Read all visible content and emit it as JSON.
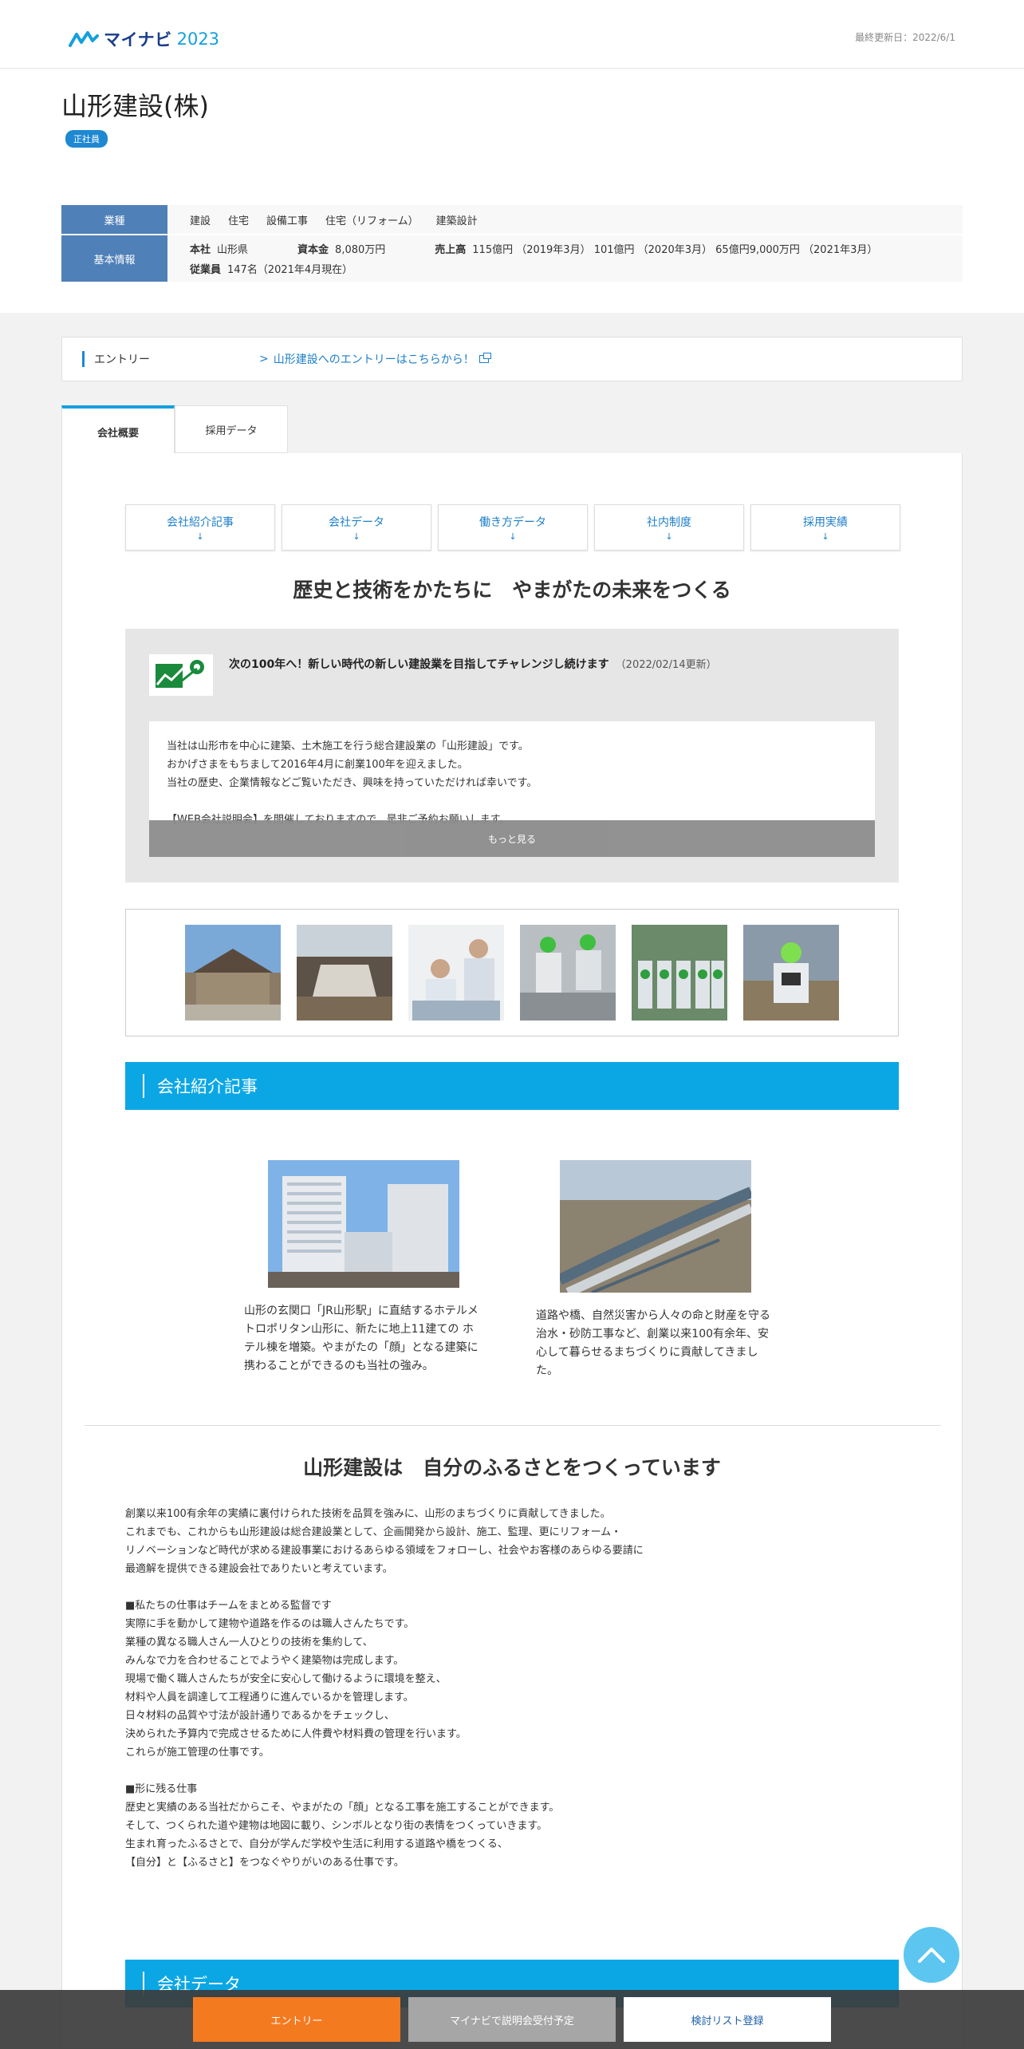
{
  "header": {
    "logo_text": "マイナビ",
    "logo_year": "2023",
    "updated": "最終更新日：2022/6/1"
  },
  "company": {
    "name": "山形建設(株)",
    "badge": "正社員"
  },
  "info": {
    "industry_label": "業種",
    "industries": [
      "建設",
      "住宅",
      "設備工事",
      "住宅（リフォーム）",
      "建築設計"
    ],
    "basic_label": "基本情報",
    "hq_key": "本社",
    "hq_val": "山形県",
    "capital_key": "資本金",
    "capital_val": "8,080万円",
    "sales_key": "売上高",
    "sales_val": "115億円 （2019年3月） 101億円 （2020年3月） 65億円9,000万円 （2021年3月）",
    "employees_key": "従業員",
    "employees_val": "147名（2021年4月現在）"
  },
  "entry": {
    "label": "エントリー",
    "link": "山形建設へのエントリーはこちらから！"
  },
  "tabs": [
    "会社概要",
    "採用データ"
  ],
  "anchors": [
    {
      "label": "会社紹介記事",
      "arrow": "↓"
    },
    {
      "label": "会社データ",
      "arrow": "↓"
    },
    {
      "label": "働き方データ",
      "arrow": "↓"
    },
    {
      "label": "社内制度",
      "arrow": "↓"
    },
    {
      "label": "採用実績",
      "arrow": "↓"
    }
  ],
  "catch1": "歴史と技術をかたちに　やまがたの未来をつくる",
  "news": {
    "title": "次の100年へ！新しい時代の新しい建設業を目指してチャレンジし続けます",
    "date": "（2022/02/14更新）",
    "lines": [
      "当社は山形市を中心に建築、土木施工を行う総合建設業の「山形建設」です。",
      "おかげさまをもちまして2016年4月に創業100年を迎えました。",
      "当社の歴史、企業情報などご覧いただき、興味を持っていただければ幸いです。",
      "",
      "【WEB会社説明会】を開催しておりますので、是非ご予約お願いします。"
    ],
    "more": "もっと見る"
  },
  "section1": "会社紹介記事",
  "articles": [
    "山形の玄関口「JR山形駅」に直結するホテルメトロポリタン山形に、新たに地上11建ての ホテル棟を増築。やまがたの「顔」となる建築に携わることができるのも当社の強み。",
    "道路や橋、自然災害から人々の命と財産を守る治水・砂防工事など、創業以来100有余年、安心して暮らせるまちづくりに貢献してきました。"
  ],
  "catch2": "山形建設は　自分のふるさとをつくっています",
  "body": "創業以来100有余年の実績に裏付けられた技術を品質を強みに、山形のまちづくりに貢献してきました。\nこれまでも、これからも山形建設は総合建設業として、企画開発から設計、施工、監理、更にリフォーム・\nリノベーションなど時代が求める建設事業におけるあらゆる領域をフォローし、社会やお客様のあらゆる要請に\n最適解を提供できる建設会社でありたいと考えています。\n\n■私たちの仕事はチームをまとめる監督です\n実際に手を動かして建物や道路を作るのは職人さんたちです。\n業種の異なる職人さん一人ひとりの技術を集約して、\nみんなで力を合わせることでようやく建築物は完成します。\n現場で働く職人さんたちが安全に安心して働けるように環境を整え、\n材料や人員を調達して工程通りに進んでいるかを管理します。\n日々材料の品質や寸法が設計通りであるかをチェックし、\n決められた予算内で完成させるために人件費や材料費の管理を行います。\nこれらが施工管理の仕事です。\n\n■形に残る仕事\n歴史と実績のある当社だからこそ、やまがたの「顔」となる工事を施工することができます。\nそして、つくられた道や建物は地図に載り、シンボルとなり街の表情をつくっていきます。\n生まれ育ったふるさとで、自分が学んだ学校や生活に利用する道路や橋をつくる、\n【自分】と【ふるさと】をつなぐやりがいのある仕事です。",
  "section2": "会社データ",
  "bottom": {
    "entry": "エントリー",
    "seminar": "マイナビで説明会受付予定",
    "list": "検討リスト登録"
  },
  "colors": {
    "accent": "#0ba7e5",
    "label_bg": "#4f80b8",
    "entry_btn": "#f47a20"
  }
}
